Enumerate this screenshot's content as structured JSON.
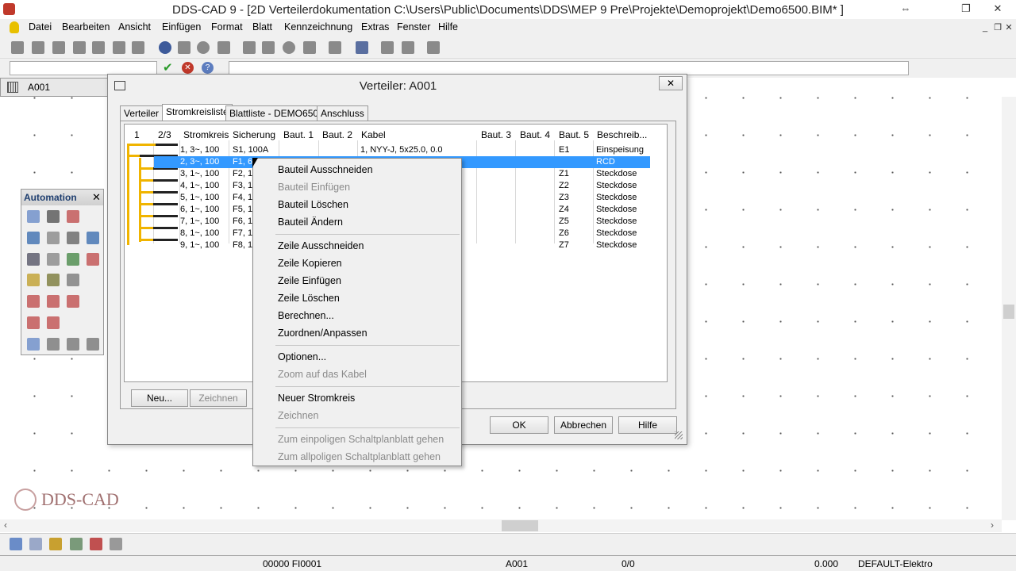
{
  "window": {
    "title": "DDS-CAD 9 - [2D  Verteilerdokumentation  C:\\Users\\Public\\Documents\\DDS\\MEP 9 Pre\\Projekte\\Demoprojekt\\Demo6500.BIM* ]"
  },
  "menu": [
    "Datei",
    "Bearbeiten",
    "Ansicht",
    "Einfügen",
    "Format",
    "Blatt",
    "Kennzeichnung",
    "Extras",
    "Fenster",
    "Hilfe"
  ],
  "doc_tab": "A001",
  "automation": {
    "title": "Automation"
  },
  "dialog": {
    "title": "Verteiler:  A001",
    "tabs": [
      "Verteiler",
      "Stromkreisliste",
      "Blattliste - DEMO6500",
      "Anschluss"
    ],
    "columns": [
      "1",
      "2/3",
      "Stromkreis",
      "Sicherung",
      "Baut. 1",
      "Baut. 2",
      "Kabel",
      "Baut. 3",
      "Baut. 4",
      "Baut. 5",
      "Beschreib..."
    ],
    "rows": [
      {
        "stromkreis": "1, 3~, 100",
        "sicherung": "S1, 100A",
        "kabel": "1, NYY-J, 5x25.0, 0.0",
        "baut5": "E1",
        "beschreib": "Einspeisung"
      },
      {
        "stromkreis": "2, 3~, 100",
        "sicherung": "F1, 63A",
        "kabel": "",
        "baut5": "",
        "beschreib": "RCD"
      },
      {
        "stromkreis": "3, 1~, 100",
        "sicherung": "F2, 16",
        "kabel": "",
        "baut5": "Z1",
        "beschreib": "Steckdose"
      },
      {
        "stromkreis": "4, 1~, 100",
        "sicherung": "F3, 16",
        "kabel": "",
        "baut5": "Z2",
        "beschreib": "Steckdose"
      },
      {
        "stromkreis": "5, 1~, 100",
        "sicherung": "F4, 16",
        "kabel": "",
        "baut5": "Z3",
        "beschreib": "Steckdose"
      },
      {
        "stromkreis": "6, 1~, 100",
        "sicherung": "F5, 16",
        "kabel": "",
        "baut5": "Z4",
        "beschreib": "Steckdose"
      },
      {
        "stromkreis": "7, 1~, 100",
        "sicherung": "F6, 16",
        "kabel": "",
        "baut5": "Z5",
        "beschreib": "Steckdose"
      },
      {
        "stromkreis": "8, 1~, 100",
        "sicherung": "F7, 16",
        "kabel": "",
        "baut5": "Z6",
        "beschreib": "Steckdose"
      },
      {
        "stromkreis": "9, 1~, 100",
        "sicherung": "F8, 16",
        "kabel": "",
        "baut5": "Z7",
        "beschreib": "Steckdose"
      }
    ],
    "buttons": {
      "neu": "Neu...",
      "zeichnen": "Zeichnen",
      "ok": "OK",
      "abbrechen": "Abbrechen",
      "hilfe": "Hilfe"
    }
  },
  "context_menu": [
    {
      "label": "Bauteil Ausschneiden",
      "enabled": true
    },
    {
      "label": "Bauteil Einfügen",
      "enabled": false
    },
    {
      "label": "Bauteil Löschen",
      "enabled": true
    },
    {
      "label": "Bauteil Ändern",
      "enabled": true
    },
    {
      "label": "Zeile Ausschneiden",
      "enabled": true
    },
    {
      "label": "Zeile Kopieren",
      "enabled": true
    },
    {
      "label": "Zeile Einfügen",
      "enabled": true
    },
    {
      "label": "Zeile Löschen",
      "enabled": true
    },
    {
      "label": "Berechnen...",
      "enabled": true
    },
    {
      "label": "Zuordnen/Anpassen",
      "enabled": true
    },
    {
      "label": "Optionen...",
      "enabled": true
    },
    {
      "label": "Zoom auf das Kabel",
      "enabled": false
    },
    {
      "label": "Neuer Stromkreis",
      "enabled": true
    },
    {
      "label": "Zeichnen",
      "enabled": false
    },
    {
      "label": "Zum einpoligen Schaltplanblatt gehen",
      "enabled": false
    },
    {
      "label": "Zum allpoligen Schaltplanblatt gehen",
      "enabled": false
    }
  ],
  "logo": "DDS-CAD",
  "status": {
    "field1": "00000 FI0001",
    "field2": "A001",
    "field3": "0/0",
    "field4": "0.000",
    "field5": "DEFAULT-Elektro"
  },
  "colors": {
    "selection": "#3399ff",
    "tree": "#f0b400"
  }
}
